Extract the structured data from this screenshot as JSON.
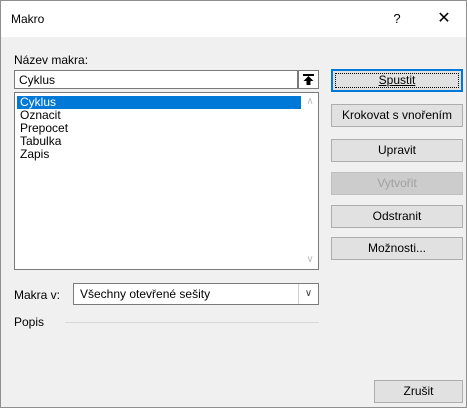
{
  "window": {
    "title": "Makro",
    "help_glyph": "?",
    "close_glyph": "✕"
  },
  "macro_name": {
    "label": "Název makra:",
    "value": "Cyklus"
  },
  "macro_list": {
    "items": [
      {
        "label": "Cyklus",
        "selected": true
      },
      {
        "label": "Oznacit",
        "selected": false
      },
      {
        "label": "Prepocet",
        "selected": false
      },
      {
        "label": "Tabulka",
        "selected": false
      },
      {
        "label": "Zapis",
        "selected": false
      }
    ]
  },
  "buttons": {
    "run": "Spustit",
    "step_into": "Krokovat s vnořením",
    "edit": "Upravit",
    "create": "Vytvořit",
    "delete": "Odstranit",
    "options": "Možnosti...",
    "cancel": "Zrušit"
  },
  "macros_in": {
    "label": "Makra v:",
    "value": "Všechny otevřené sešity"
  },
  "description": {
    "label": "Popis"
  },
  "colors": {
    "accent": "#0078d7"
  }
}
